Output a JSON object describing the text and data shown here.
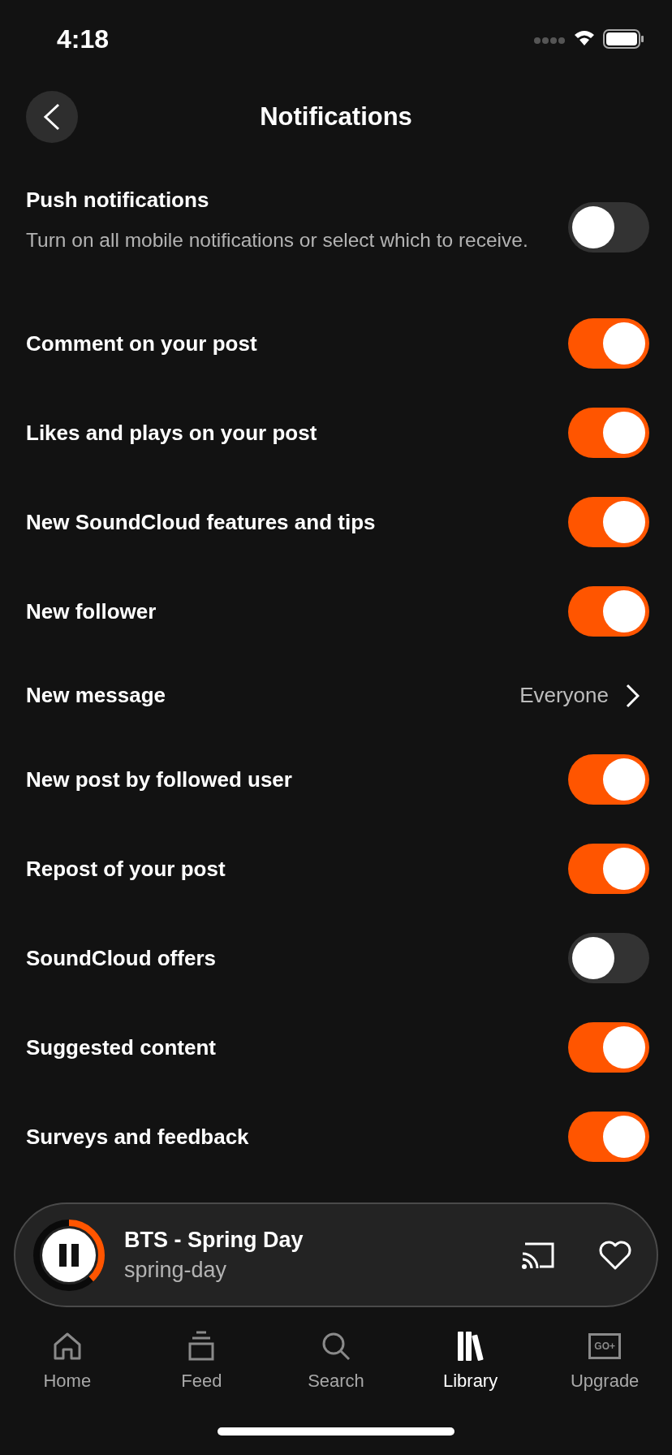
{
  "status_bar": {
    "time": "4:18"
  },
  "header": {
    "title": "Notifications"
  },
  "push": {
    "title": "Push notifications",
    "description": "Turn on all mobile notifications or select which to receive.",
    "on": false
  },
  "settings": [
    {
      "kind": "toggle",
      "label": "Comment on your post",
      "on": true
    },
    {
      "kind": "toggle",
      "label": "Likes and plays on your post",
      "on": true
    },
    {
      "kind": "toggle",
      "label": "New SoundCloud features and tips",
      "on": true
    },
    {
      "kind": "toggle",
      "label": "New follower",
      "on": true
    },
    {
      "kind": "link",
      "label": "New message",
      "value": "Everyone"
    },
    {
      "kind": "toggle",
      "label": "New post by followed user",
      "on": true
    },
    {
      "kind": "toggle",
      "label": "Repost of your post",
      "on": true
    },
    {
      "kind": "toggle",
      "label": "SoundCloud offers",
      "on": false
    },
    {
      "kind": "toggle",
      "label": "Suggested content",
      "on": true
    },
    {
      "kind": "toggle",
      "label": "Surveys and feedback",
      "on": true
    }
  ],
  "player": {
    "title": "BTS - Spring Day",
    "subtitle": "spring-day",
    "level": 0.38,
    "playing": true
  },
  "tab_bar": [
    {
      "kind": "home",
      "label": "Home",
      "selected": false
    },
    {
      "kind": "feed",
      "label": "Feed",
      "selected": false
    },
    {
      "kind": "search",
      "label": "Search",
      "selected": false
    },
    {
      "kind": "library",
      "label": "Library",
      "selected": true
    },
    {
      "kind": "upgrade",
      "label": "Upgrade",
      "icon_text": "GO+",
      "selected": false
    }
  ]
}
